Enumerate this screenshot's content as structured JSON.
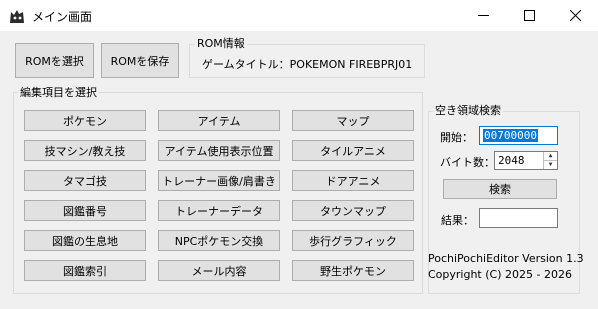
{
  "window": {
    "title": "メイン画面",
    "icon": "cat-app-icon"
  },
  "toolbar": {
    "select_rom": "ROMを選択",
    "save_rom": "ROMを保存"
  },
  "rom_info": {
    "legend": "ROM情報",
    "game_title": "ゲームタイトル：POKEMON FIREBPRJ01"
  },
  "edit": {
    "legend": "編集項目を選択",
    "buttons": [
      [
        "ポケモン",
        "アイテム",
        "マップ"
      ],
      [
        "技マシン/教え技",
        "アイテム使用表示位置",
        "タイルアニメ"
      ],
      [
        "タマゴ技",
        "トレーナー画像/肩書き",
        "ドアアニメ"
      ],
      [
        "図鑑番号",
        "トレーナーデータ",
        "タウンマップ"
      ],
      [
        "図鑑の生息地",
        "NPCポケモン交換",
        "歩行グラフィック"
      ],
      [
        "図鑑索引",
        "メール内容",
        "野生ポケモン"
      ]
    ]
  },
  "free_space": {
    "legend": "空き領域検索",
    "start_label": "開始：",
    "start_value": "00700000",
    "bytes_label": "バイト数：",
    "bytes_value": "2048",
    "search_button": "検索",
    "result_label": "結果：",
    "result_value": ""
  },
  "footer": {
    "version": "PochiPochiEditor Version 1.3",
    "copyright": "Copyright (C) 2025 - 2026"
  },
  "colors": {
    "selection": "#0078d7",
    "button_bg": "#e1e1e1",
    "window_bg": "#f0f0f0"
  }
}
